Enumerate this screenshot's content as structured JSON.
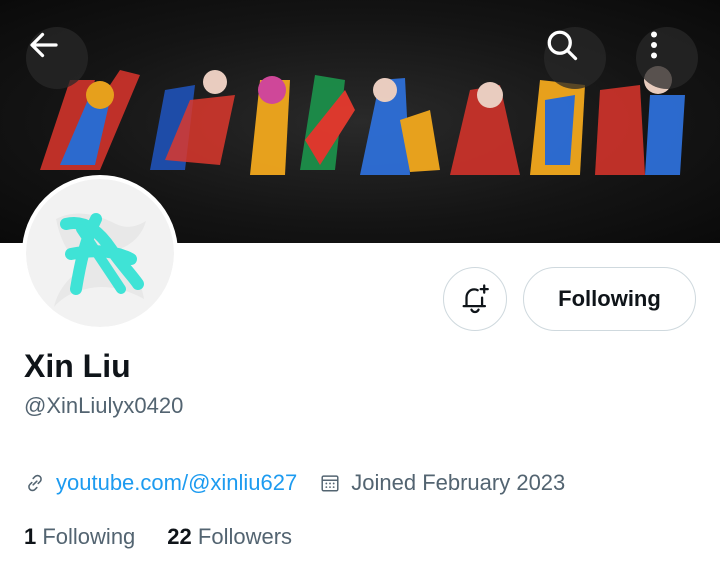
{
  "header": {
    "back_icon": "arrow-left-icon",
    "search_icon": "search-icon",
    "more_icon": "more-vertical-icon"
  },
  "banner": {
    "description_colors": [
      "#e63a2e",
      "#2e6fd8",
      "#f2a81d",
      "#1c8f4a",
      "#d94aa0"
    ]
  },
  "avatar": {
    "accent": "#3fe3d6"
  },
  "actions": {
    "notify_icon": "bell-plus-icon",
    "follow_label": "Following"
  },
  "profile": {
    "name": "Xin Liu",
    "handle": "@XinLiulyx0420",
    "website": "youtube.com/@xinliu627",
    "joined": "Joined February 2023"
  },
  "stats": {
    "following_count": "1",
    "following_label": "Following",
    "followers_count": "22",
    "followers_label": "Followers"
  },
  "colors": {
    "link": "#1d9bf0",
    "secondary_text": "#536471",
    "primary_text": "#0f1419",
    "border": "#cfd9de"
  }
}
